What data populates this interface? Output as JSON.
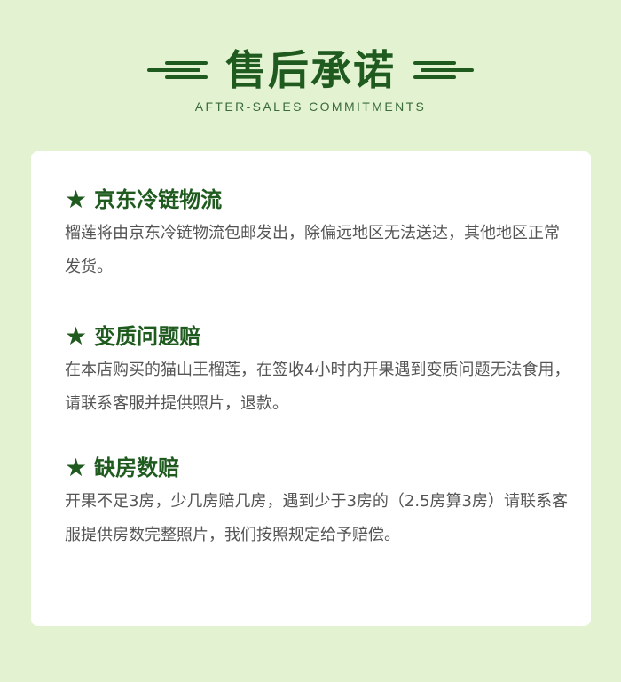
{
  "header": {
    "title": "售后承诺",
    "subtitle": "AFTER-SALES COMMITMENTS"
  },
  "sections": [
    {
      "icon": "star-icon",
      "title": "京东冷链物流",
      "body": "榴莲将由京东冷链物流包邮发出，除偏远地区无法送达，其他地区正常发货。"
    },
    {
      "icon": "star-icon",
      "title": "变质问题赔",
      "body": "在本店购买的猫山王榴莲，在签收4小时内开果遇到变质问题无法食用，请联系客服并提供照片，退款。"
    },
    {
      "icon": "star-icon",
      "title": "缺房数赔",
      "body": "开果不足3房，少几房赔几房，遇到少于3房的（2.5房算3房）请联系客服提供房数完整照片，我们按照规定给予赔偿。"
    }
  ],
  "colors": {
    "background": "#e3f3d2",
    "accent": "#1f5a1f",
    "card": "#ffffff",
    "body_text": "#555555"
  }
}
